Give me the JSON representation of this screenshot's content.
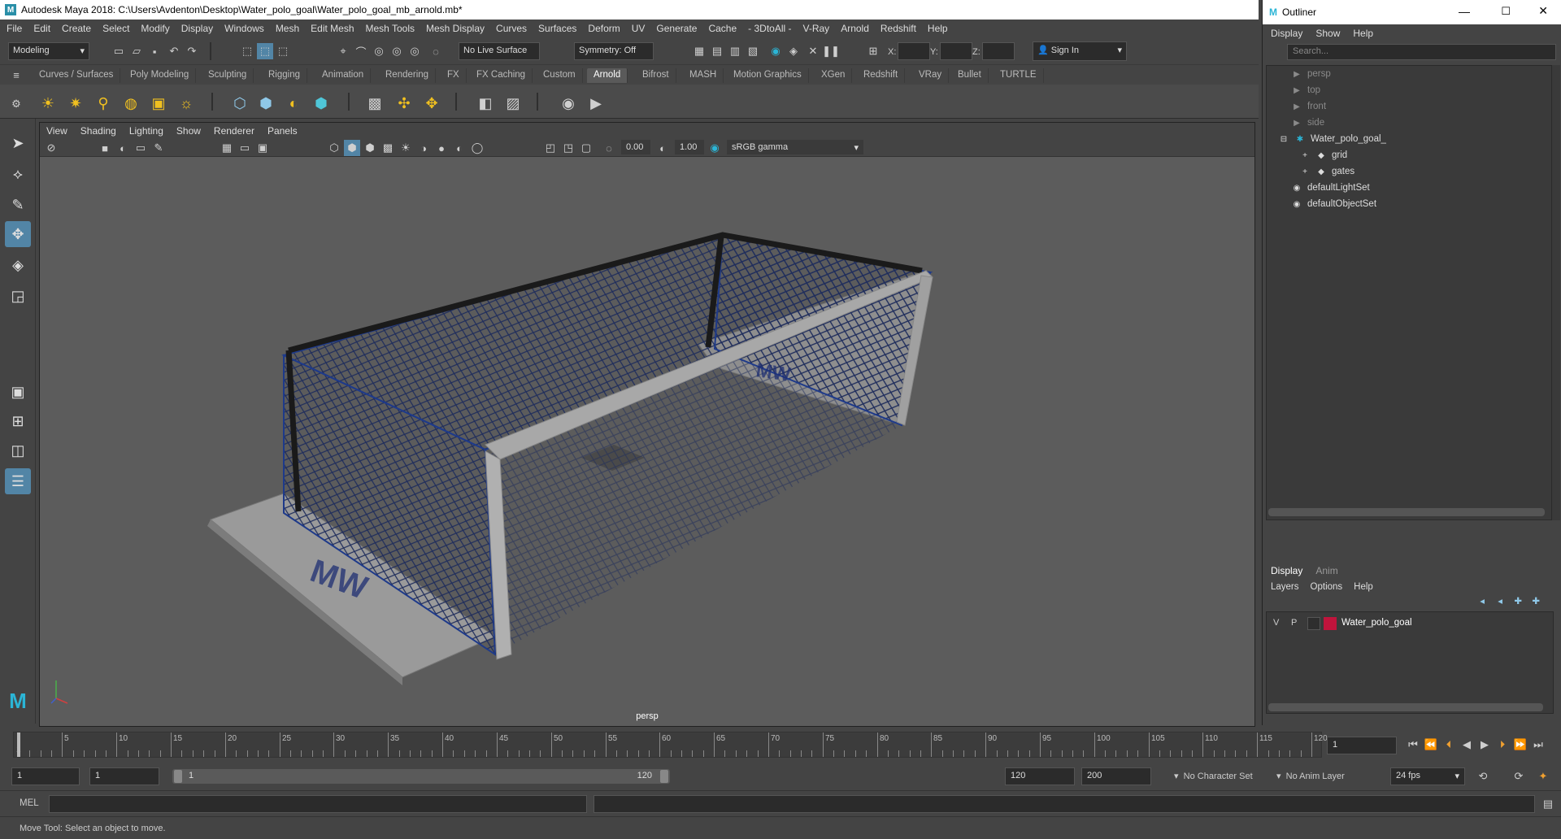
{
  "window": {
    "title": "Autodesk Maya 2018: C:\\Users\\Avdenton\\Desktop\\Water_polo_goal\\Water_polo_goal_mb_arnold.mb*"
  },
  "menubar": [
    "File",
    "Edit",
    "Create",
    "Select",
    "Modify",
    "Display",
    "Windows",
    "Mesh",
    "Edit Mesh",
    "Mesh Tools",
    "Mesh Display",
    "Curves",
    "Surfaces",
    "Deform",
    "UV",
    "Generate",
    "Cache",
    "- 3DtoAll -",
    "V-Ray",
    "Arnold",
    "Redshift",
    "Help"
  ],
  "statusline": {
    "mode": "Modeling",
    "live_surface": "No Live Surface",
    "symmetry": "Symmetry: Off",
    "x_label": "X:",
    "y_label": "Y:",
    "z_label": "Z:",
    "sign_in": "Sign In"
  },
  "shelf_tabs": [
    "Curves / Surfaces",
    "Poly Modeling",
    "Sculpting",
    "Rigging",
    "Animation",
    "Rendering",
    "FX",
    "FX Caching",
    "Custom",
    "Arnold",
    "Bifrost",
    "MASH",
    "Motion Graphics",
    "XGen",
    "Redshift",
    "VRay",
    "Bullet",
    "TURTLE"
  ],
  "active_shelf_tab": "Arnold",
  "panel_menu": [
    "View",
    "Shading",
    "Lighting",
    "Show",
    "Renderer",
    "Panels"
  ],
  "panel_toolbar": {
    "exposure": "0.00",
    "gamma": "1.00",
    "color_space": "sRGB gamma"
  },
  "viewport": {
    "camera": "persp"
  },
  "outliner": {
    "title": "Outliner",
    "menus": [
      "Display",
      "Show",
      "Help"
    ],
    "search_placeholder": "Search...",
    "nodes": [
      {
        "label": "persp",
        "dim": true
      },
      {
        "label": "top",
        "dim": true
      },
      {
        "label": "front",
        "dim": true
      },
      {
        "label": "side",
        "dim": true
      },
      {
        "label": "Water_polo_goal_",
        "dim": false
      },
      {
        "label": "grid",
        "dim": false
      },
      {
        "label": "gates",
        "dim": false
      },
      {
        "label": "defaultLightSet",
        "dim": false
      },
      {
        "label": "defaultObjectSet",
        "dim": false
      }
    ]
  },
  "layer_editor": {
    "tabs": [
      "Display",
      "Anim"
    ],
    "menus": [
      "Layers",
      "Options",
      "Help"
    ],
    "layer": {
      "v": "V",
      "p": "P",
      "name": "Water_polo_goal",
      "color": "#c0143c"
    }
  },
  "timeline": {
    "ticks": [
      "5",
      "10",
      "15",
      "20",
      "25",
      "30",
      "35",
      "40",
      "45",
      "50",
      "55",
      "60",
      "65",
      "70",
      "75",
      "80",
      "85",
      "90",
      "95",
      "100",
      "105",
      "110",
      "115",
      "120"
    ],
    "current_frame": "1",
    "start_marker": "1"
  },
  "range": {
    "start": "1",
    "playback_start": "1",
    "range_slider_start": "1",
    "range_slider_end": "120",
    "playback_end": "120",
    "end": "200",
    "character_set": "No Character Set",
    "anim_layer": "No Anim Layer",
    "fps": "24 fps"
  },
  "cmdline": {
    "label": "MEL"
  },
  "helpline": {
    "text": "Move Tool: Select an object to move."
  }
}
